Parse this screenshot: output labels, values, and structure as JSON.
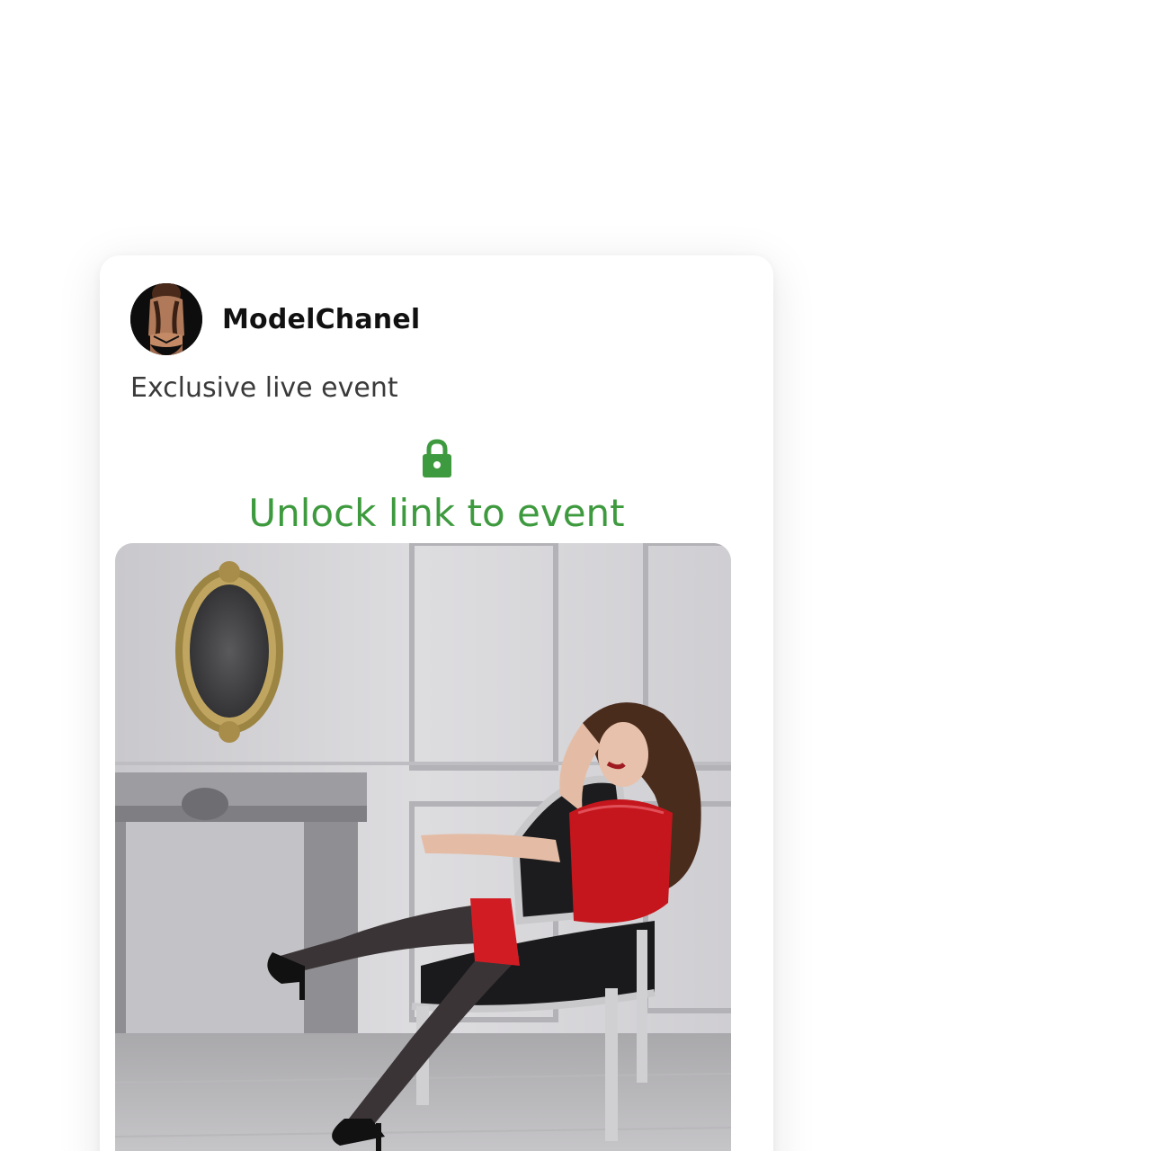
{
  "post": {
    "author": "ModelChanel",
    "caption": "Exclusive live event",
    "unlock_label": "Unlock link to event",
    "accent_color": "#3e9a3e"
  },
  "icons": {
    "lock": "lock-icon"
  }
}
